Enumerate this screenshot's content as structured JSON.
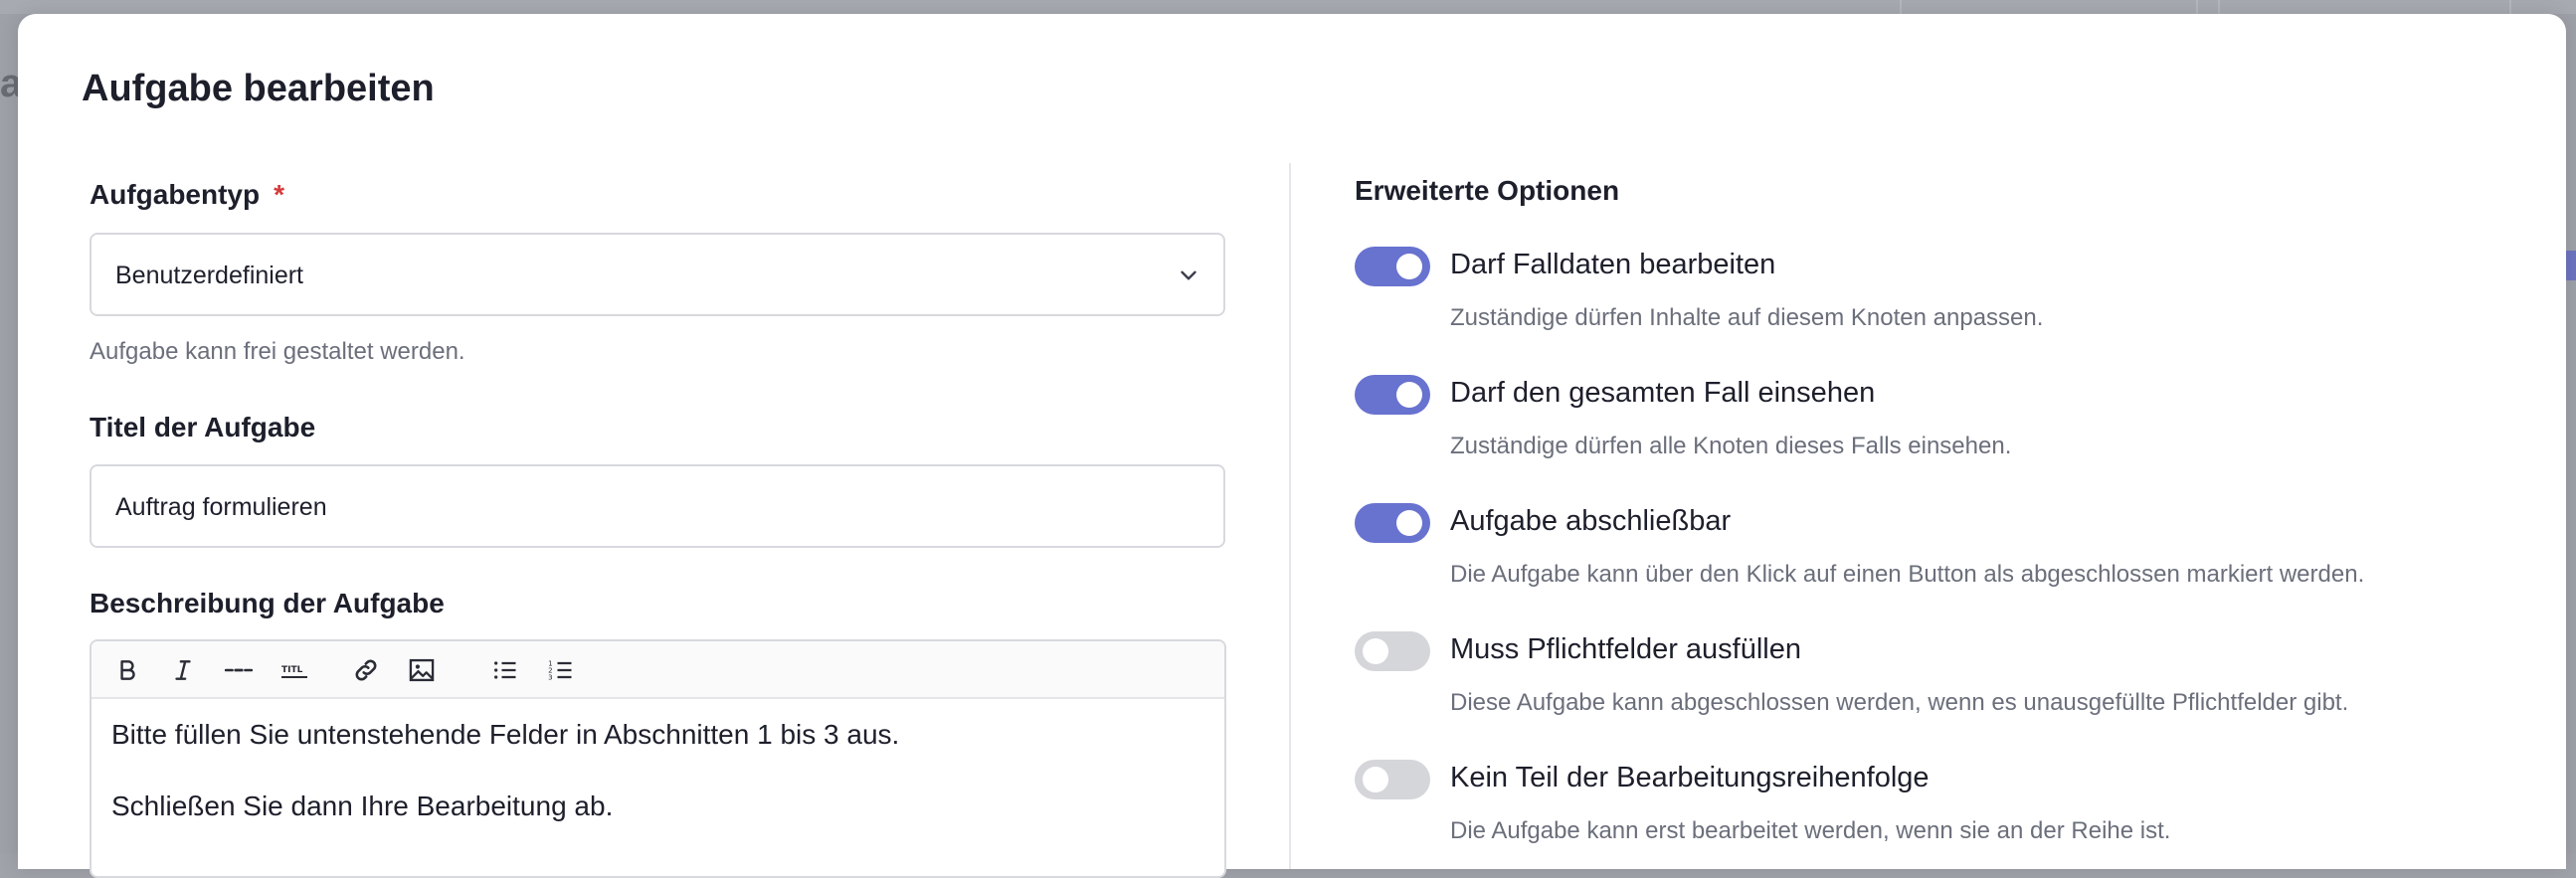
{
  "background": {
    "partial_left_char": "a"
  },
  "modal": {
    "title": "Aufgabe bearbeiten"
  },
  "task_type": {
    "label": "Aufgabentyp",
    "required_marker": "*",
    "selected": "Benutzerdefiniert",
    "help": "Aufgabe kann frei gestaltet werden."
  },
  "task_title": {
    "label": "Titel der Aufgabe",
    "value": "Auftrag formulieren"
  },
  "task_description": {
    "label": "Beschreibung der Aufgabe",
    "toolbar": [
      "bold-icon",
      "italic-icon",
      "horizontal-rule-icon",
      "title-icon",
      "link-icon",
      "image-icon",
      "bullet-list-icon",
      "numbered-list-icon"
    ],
    "lines": [
      "Bitte füllen Sie untenstehende Felder in Abschnitten 1 bis 3 aus.",
      "Schließen Sie dann Ihre Bearbeitung ab."
    ]
  },
  "advanced": {
    "heading": "Erweiterte Optionen",
    "options": [
      {
        "label": "Darf Falldaten bearbeiten",
        "description": "Zuständige dürfen Inhalte auf diesem Knoten anpassen.",
        "enabled": true
      },
      {
        "label": "Darf den gesamten Fall einsehen",
        "description": "Zuständige dürfen alle Knoten dieses Falls einsehen.",
        "enabled": true
      },
      {
        "label": "Aufgabe abschließbar",
        "description": "Die Aufgabe kann über den Klick auf einen Button als abgeschlossen markiert werden.",
        "enabled": true
      },
      {
        "label": "Muss Pflichtfelder ausfüllen",
        "description": "Diese Aufgabe kann abgeschlossen werden, wenn es unausgefüllte Pflichtfelder gibt.",
        "enabled": false
      },
      {
        "label": "Kein Teil der Bearbeitungsreihenfolge",
        "description": "Die Aufgabe kann erst bearbeitet werden, wenn sie an der Reihe ist.",
        "enabled": false
      }
    ]
  },
  "colors": {
    "accent": "#6872cf",
    "toggle_off": "#d5d6da",
    "required": "#d63a3a"
  }
}
